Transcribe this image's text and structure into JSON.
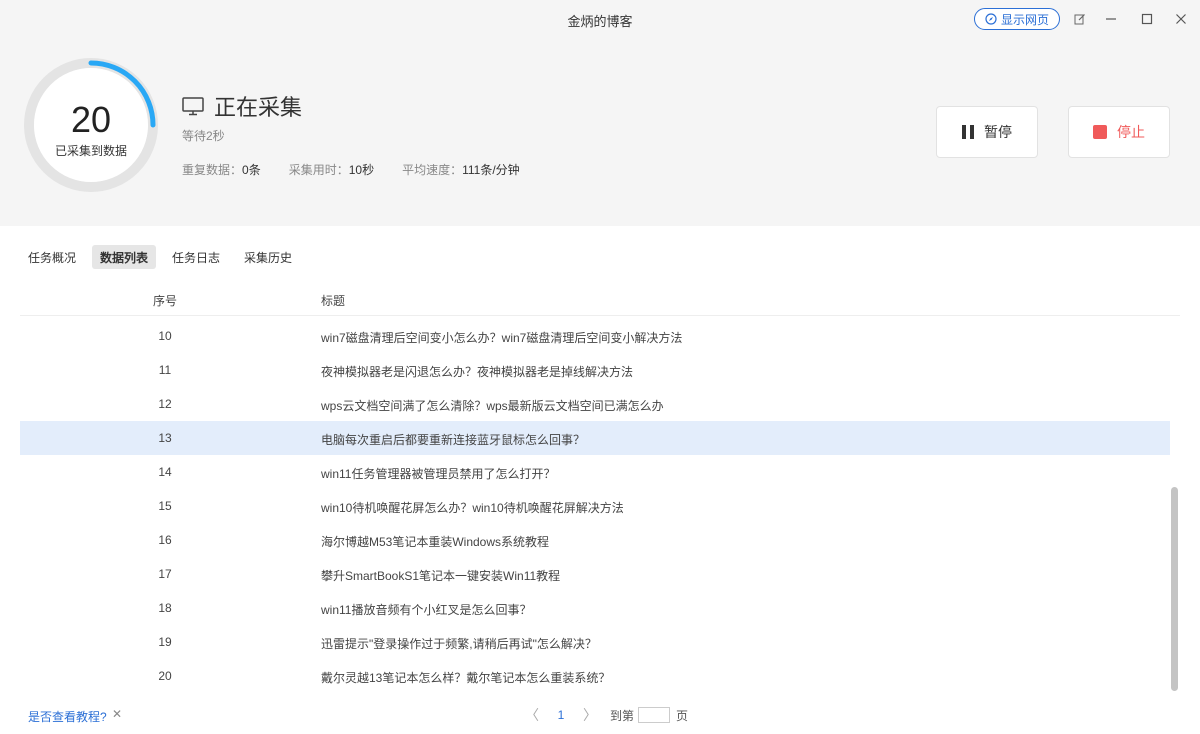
{
  "window": {
    "title": "金炳的博客",
    "show_web_label": "显示网页"
  },
  "progress": {
    "count": "20",
    "count_label": "已采集到数据",
    "ring_fraction": 0.25,
    "ring_color": "#29a8f5"
  },
  "status": {
    "text": "正在采集",
    "wait": "等待2秒",
    "stats": [
      {
        "label": "重复数据：",
        "value": "0条"
      },
      {
        "label": "采集用时：",
        "value": "10秒"
      },
      {
        "label": "平均速度：",
        "value": "111条/分钟"
      }
    ]
  },
  "actions": {
    "pause_label": "暂停",
    "stop_label": "停止",
    "stop_color": "#f05a5a"
  },
  "tabs": [
    {
      "label": "任务概况",
      "active": false
    },
    {
      "label": "数据列表",
      "active": true
    },
    {
      "label": "任务日志",
      "active": false
    },
    {
      "label": "采集历史",
      "active": false
    }
  ],
  "table": {
    "columns": [
      "序号",
      "标题"
    ],
    "rows": [
      {
        "no": "10",
        "title": "win7磁盘清理后空间变小怎么办？win7磁盘清理后空间变小解决方法"
      },
      {
        "no": "11",
        "title": "夜神模拟器老是闪退怎么办？夜神模拟器老是掉线解决方法"
      },
      {
        "no": "12",
        "title": "wps云文档空间满了怎么清除？wps最新版云文档空间已满怎么办"
      },
      {
        "no": "13",
        "title": "电脑每次重启后都要重新连接蓝牙鼠标怎么回事？"
      },
      {
        "no": "14",
        "title": "win11任务管理器被管理员禁用了怎么打开？"
      },
      {
        "no": "15",
        "title": "win10待机唤醒花屏怎么办？win10待机唤醒花屏解决方法"
      },
      {
        "no": "16",
        "title": "海尔博越M53笔记本重装Windows系统教程"
      },
      {
        "no": "17",
        "title": "攀升SmartBookS1笔记本一键安装Win11教程"
      },
      {
        "no": "18",
        "title": "win11播放音频有个小红叉是怎么回事？"
      },
      {
        "no": "19",
        "title": "迅雷提示\"登录操作过于频繁,请稍后再试\"怎么解决？"
      },
      {
        "no": "20",
        "title": "戴尔灵越13笔记本怎么样？戴尔笔记本怎么重装系统？"
      }
    ],
    "selected_index": 3
  },
  "footer": {
    "help_text": "是否查看教程?",
    "close_glyph": "✕",
    "prev_glyph": "〈",
    "next_glyph": "〉",
    "current_page": "1",
    "goto_label": "到第",
    "page_suffix": "页"
  }
}
